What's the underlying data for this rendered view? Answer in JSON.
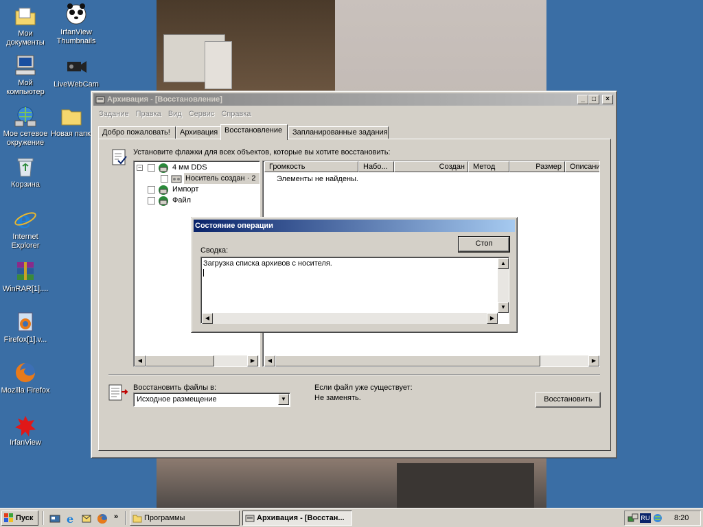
{
  "desktop": {
    "icons": [
      {
        "label": "Мои документы",
        "icon": "my-documents-folder-icon"
      },
      {
        "label": "IrfanView Thumbnails",
        "icon": "panda-icon"
      },
      {
        "label": "Мой компьютер",
        "icon": "my-computer-icon"
      },
      {
        "label": "LiveWebCam",
        "icon": "camera-icon"
      },
      {
        "label": "Мое сетевое окружение",
        "icon": "network-places-icon"
      },
      {
        "label": "Новая папка",
        "icon": "folder-icon"
      },
      {
        "label": "Корзина",
        "icon": "recycle-bin-icon"
      },
      {
        "label": "Internet Explorer",
        "icon": "internet-explorer-icon"
      },
      {
        "label": "WinRAR[1]....",
        "icon": "winrar-icon"
      },
      {
        "label": "Firefox[1].v...",
        "icon": "firefox-installer-icon"
      },
      {
        "label": "Mozilla Firefox",
        "icon": "firefox-icon"
      },
      {
        "label": "IrfanView",
        "icon": "irfanview-icon"
      }
    ]
  },
  "window": {
    "title": "Архивация - [Восстановление]",
    "menu": [
      "Задание",
      "Правка",
      "Вид",
      "Сервис",
      "Справка"
    ],
    "tabs": [
      "Добро пожаловать!",
      "Архивация",
      "Восстановление",
      "Запланированные задания"
    ],
    "active_tab": "Восстановление",
    "instruction": "Установите флажки для всех объектов, которые вы хотите восстановить:",
    "tree": [
      "4 мм DDS",
      "Носитель создан · 2",
      "Импорт",
      "Файл"
    ],
    "columns": [
      "Громкость",
      "Набо...",
      "Создан",
      "Метод",
      "Размер",
      "Описани"
    ],
    "empty_message": "Элементы не найдены.",
    "restore_to_label": "Восстановить файлы в:",
    "restore_to_value": "Исходное размещение",
    "if_exists_label": "Если файл уже существует:",
    "if_exists_value": "Не заменять.",
    "restore_button": "Восстановить"
  },
  "dialog": {
    "title": "Состояние операции",
    "stop_button": "Стоп",
    "summary_label": "Сводка:",
    "summary_text": "Загрузка списка архивов с носителя."
  },
  "taskbar": {
    "start_label": "Пуск",
    "tasks": [
      "Программы",
      "Архивация - [Восстан..."
    ],
    "language": "RU",
    "time": "8:20"
  },
  "colors": {
    "desktop": "#3a6ea5",
    "active_title": "#0a246a",
    "face": "#d4d0c8"
  }
}
